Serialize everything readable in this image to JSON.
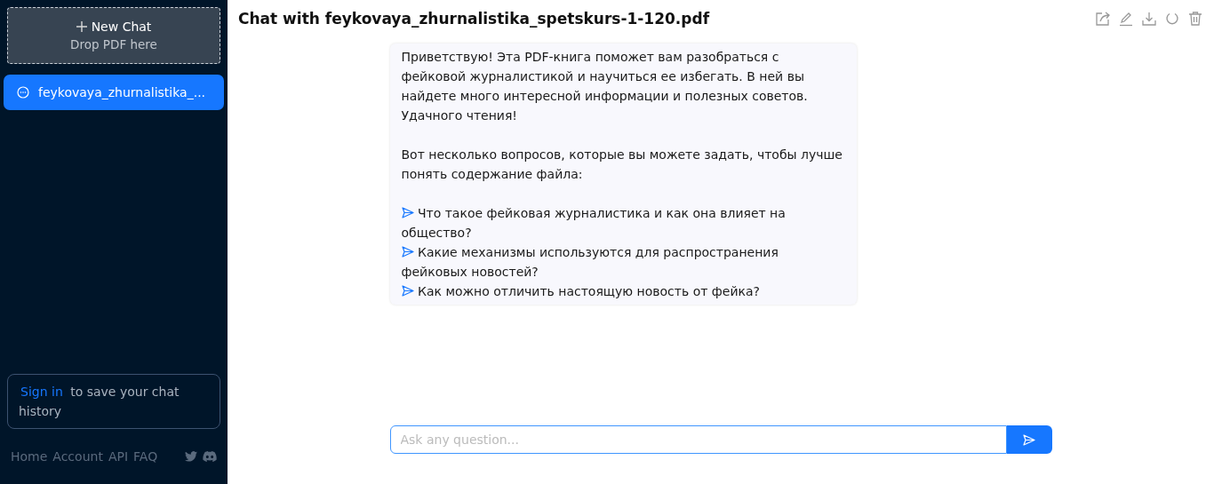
{
  "sidebar": {
    "new_chat": {
      "label": "New Chat",
      "hint": "Drop PDF here"
    },
    "chats": [
      {
        "title": "feykovaya_zhurnalistika_...",
        "selected": true
      }
    ],
    "sign_in": {
      "link": "Sign in",
      "text": "to save your chat history"
    },
    "footer_links": [
      "Home",
      "Account",
      "API",
      "FAQ"
    ]
  },
  "header": {
    "title": "Chat with feykovaya_zhurnalistika_spetskurs-1-120.pdf"
  },
  "message": {
    "paragraphs": [
      "Приветствую! Эта PDF-книга поможет вам разобраться с фейковой журналистикой и научиться ее избегать. В ней вы найдете много интересной информации и полезных советов. Удачного чтения!",
      "Вот несколько вопросов, которые вы можете задать, чтобы лучше понять содержание файла:"
    ],
    "questions": [
      "Что такое фейковая журналистика и как она влияет на общество?",
      "Какие механизмы используются для распространения фейковых новостей?",
      "Как можно отличить настоящую новость от фейка?"
    ]
  },
  "input": {
    "placeholder": "Ask any question..."
  }
}
